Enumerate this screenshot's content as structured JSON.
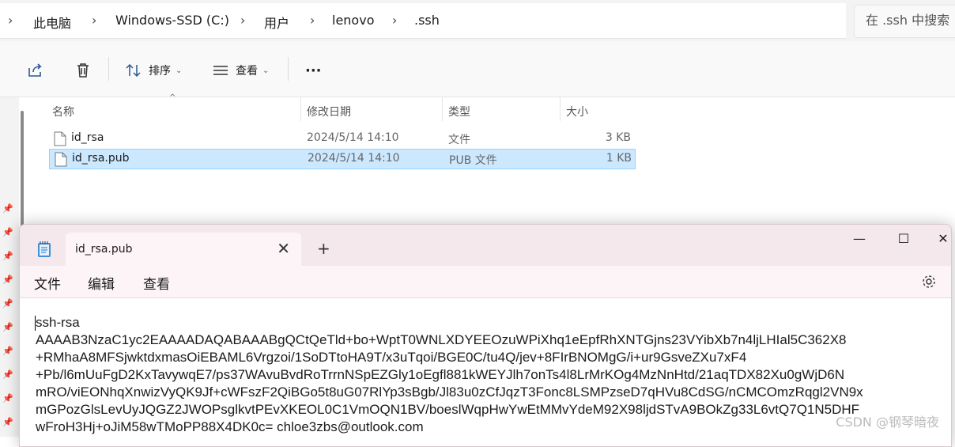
{
  "address": {
    "crumbs": [
      "此电脑",
      "Windows-SSD (C:)",
      "用户",
      "lenovo",
      ".ssh"
    ],
    "search_placeholder": "在 .ssh 中搜索"
  },
  "toolbar": {
    "share_icon": "share-icon",
    "delete_icon": "trash-icon",
    "sort_label": "排序",
    "view_label": "查看",
    "more_label": "···"
  },
  "columns": [
    "名称",
    "修改日期",
    "类型",
    "大小"
  ],
  "files": [
    {
      "name": "id_rsa",
      "date": "2024/5/14 14:10",
      "type": "文件",
      "size": "3 KB",
      "selected": false
    },
    {
      "name": "id_rsa.pub",
      "date": "2024/5/14 14:10",
      "type": "PUB 文件",
      "size": "1 KB",
      "selected": true
    }
  ],
  "notepad": {
    "tab_title": "id_rsa.pub",
    "tab_close": "✕",
    "new_tab": "+",
    "window_controls": {
      "minimize": "—",
      "maximize": "☐",
      "close": "✕"
    },
    "menu": [
      "文件",
      "编辑",
      "查看"
    ],
    "content_lines": [
      "ssh-rsa",
      "AAAAB3NzaC1yc2EAAAADAQABAAABgQCtQeTld+bo+WptT0WNLXDYEEOzuWPiXhq1eEpfRhXNTGjns23VYibXb7n4ljLHIal5C362X8",
      "+RMhaA8MFSjwktdxmasOiEBAML6Vrgzoi/1SoDTtoHA9T/x3uTqoi/BGE0C/tu4Q/jev+8FIrBNOMgG/i+ur9GsveZXu7xF4",
      "+Pb/l6mUuFgD2KxTavywqE7/ps37WAvuBvdRoTrrnNSpEZGly1oEgfl881kWEYJlh7onTs4l8LrMrKOg4MzNnHtd/21aqTDX82Xu0gWjD6N",
      "mRO/viEONhqXnwizVyQK9Jf+cWFszF2QiBGo5t8uG07RlYp3sBgb/Jl83u0zCfJqzT3Fonc8LSMPzseD7qHVu8CdSG/nCMCOmzRqgl2VN9x",
      "mGPozGlsLevUyJQGZ2JWOPsglkvtPEvXKEOL0C1VmOQN1BV/boeslWqpHwYwEtMMvYdeM92X98ljdSTvA9BOkZg33L6vtQ7Q1N5DHF",
      "wFroH3Hj+oJiM58wTMoPP88X4DK0c= chloe3zbs@outlook.com"
    ]
  },
  "watermark": "CSDN @钢琴暗夜"
}
